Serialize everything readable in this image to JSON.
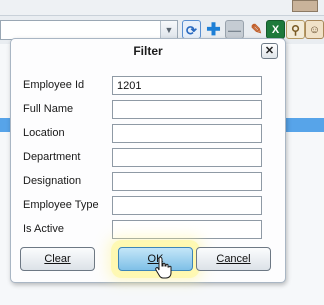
{
  "background": {
    "icons": [
      "refresh-icon",
      "add-icon",
      "remove-icon",
      "edit-icon",
      "excel-icon",
      "search-user-icon",
      "user-icon"
    ],
    "highlight_color": "#57a4e9"
  },
  "dialog": {
    "title": "Filter",
    "close_glyph": "✕",
    "fields": [
      {
        "label": "Employee Id",
        "value": "1201"
      },
      {
        "label": "Full Name",
        "value": ""
      },
      {
        "label": "Location",
        "value": ""
      },
      {
        "label": "Department",
        "value": ""
      },
      {
        "label": "Designation",
        "value": ""
      },
      {
        "label": "Employee Type",
        "value": ""
      },
      {
        "label": "Is Active",
        "value": ""
      }
    ],
    "buttons": {
      "clear": "Clear",
      "ok": "OK",
      "cancel": "Cancel"
    }
  }
}
